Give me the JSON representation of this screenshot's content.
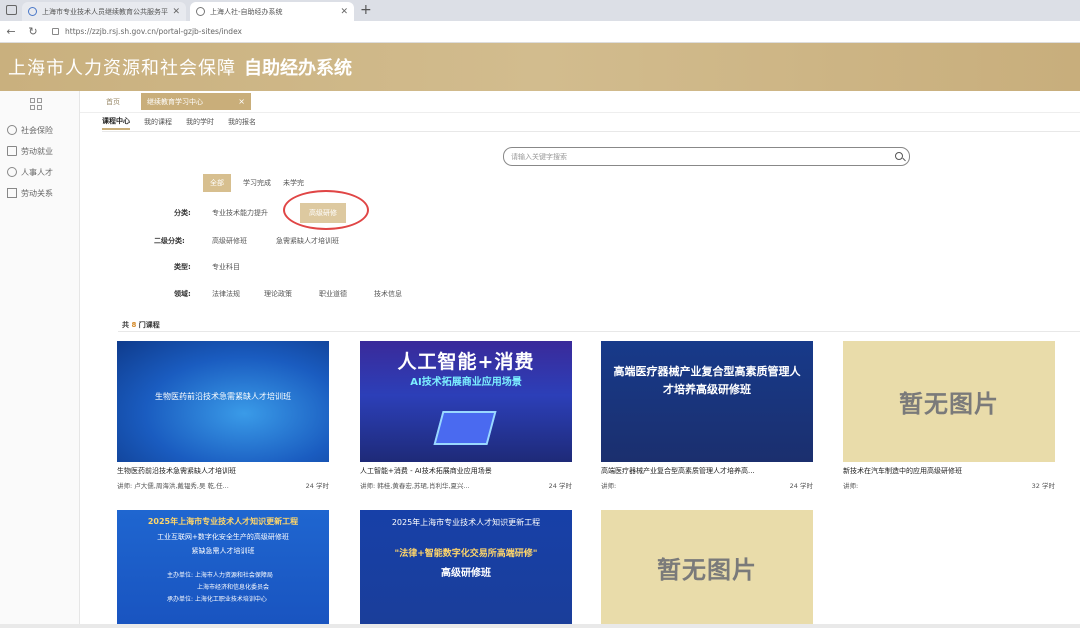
{
  "browser": {
    "tabs": [
      {
        "label": "上海市专业技术人员继续教育公共服务平台"
      },
      {
        "label": "上海人社-自助经办系统"
      }
    ],
    "new_tab": "+",
    "url": "https://zzjb.rsj.sh.gov.cn/portal-gzjb-sites/index"
  },
  "header": {
    "title": "上海市人力资源和社会保障",
    "subtitle": "自助经办系统"
  },
  "sidebar": {
    "items": [
      {
        "label": "社会保险",
        "icon": "shield-icon"
      },
      {
        "label": "劳动就业",
        "icon": "person-icon"
      },
      {
        "label": "人事人才",
        "icon": "people-icon"
      },
      {
        "label": "劳动关系",
        "icon": "document-icon"
      }
    ]
  },
  "page_tabs": {
    "home": "首页",
    "active": "继续教育学习中心",
    "close": "×"
  },
  "sub_tabs": [
    "课程中心",
    "我的课程",
    "我的学时",
    "我的报名"
  ],
  "search": {
    "placeholder": "请输入关键字搜索"
  },
  "status_chips": [
    "全部",
    "学习完成",
    "未学完"
  ],
  "filters": {
    "category": {
      "label": "分类:",
      "options": [
        "专业技术能力提升",
        "高级研修"
      ],
      "selected": "高级研修"
    },
    "subcategory": {
      "label": "二级分类:",
      "options": [
        "高级研修班",
        "急需紧缺人才培训班"
      ]
    },
    "type": {
      "label": "类型:",
      "options": [
        "专业科目"
      ]
    },
    "field": {
      "label": "领域:",
      "options": [
        "法律法规",
        "理论政策",
        "职业道德",
        "技术信息"
      ]
    }
  },
  "count": {
    "prefix": "共",
    "num": "8",
    "suffix": "门课程"
  },
  "courses": [
    {
      "thumb_title": "生物医药前沿技术急需紧缺人才培训班",
      "title": "生物医药前沿技术急需紧缺人才培训班",
      "teachers": "讲师: 卢大儒,周海洪,戴韫秀,吴 乾,任...",
      "hours": "24 学时"
    },
    {
      "thumb_title": "人工智能+消费",
      "thumb_subtitle": "AI技术拓展商业应用场景",
      "title": "人工智能+消费 - AI技术拓展商业应用场景",
      "teachers": "讲师: 韩桂,黄春宏,苏珺,肖利华,夏兴...",
      "hours": "24 学时"
    },
    {
      "thumb_title": "高端医疗器械产业复合型高素质管理人才培养高级研修班",
      "title": "高端医疗器械产业复合型高素质管理人才培养高...",
      "teachers": "讲师:",
      "hours": "24 学时"
    },
    {
      "thumb_title": "暂无图片",
      "title": "新技术在汽车制造中的应用高级研修班",
      "teachers": "讲师:",
      "hours": "32 学时"
    },
    {
      "thumb_title": "2025年上海市专业技术人才知识更新工程",
      "thumb_lines": [
        "工业互联网+数字化安全生产的高级研修班",
        "紧缺急需人才培训班",
        "主办单位: 上海市人力资源和社会保障局",
        "上海市经济和信息化委员会",
        "承办单位: 上海化工职业技术培训中心"
      ]
    },
    {
      "thumb_title": "2025年上海市专业技术人才知识更新工程",
      "thumb_subtitle": "\"法律+智能数字化交易所高端研修\"",
      "thumb_subtitle2": "高级研修班"
    },
    {
      "thumb_title": "暂无图片"
    }
  ]
}
